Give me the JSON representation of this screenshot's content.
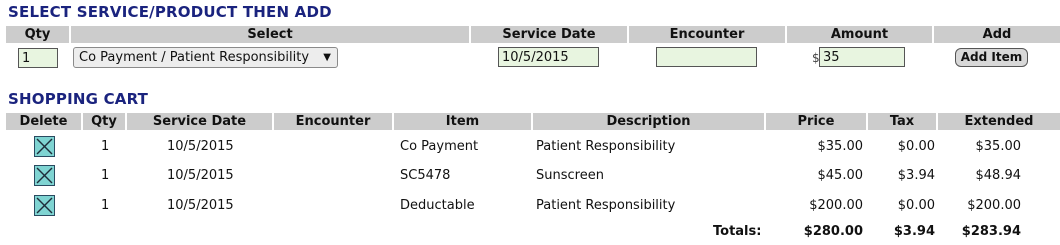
{
  "select_section": {
    "title": "SELECT SERVICE/PRODUCT THEN ADD",
    "headers": [
      "Qty",
      "Select",
      "Service Date",
      "Encounter",
      "Amount",
      "Add"
    ],
    "qty_value": "1",
    "select_value": "Co Payment / Patient Responsibility",
    "service_date_value": "10/5/2015",
    "encounter_value": "",
    "currency_symbol": "$",
    "amount_value": "35",
    "add_button_label": "Add Item"
  },
  "cart": {
    "title": "SHOPPING CART",
    "headers": [
      "Delete",
      "Qty",
      "Service Date",
      "Encounter",
      "Item",
      "Description",
      "Price",
      "Tax",
      "Extended"
    ],
    "rows": [
      {
        "qty": "1",
        "service_date": "10/5/2015",
        "encounter": "",
        "item": "Co Payment",
        "description": "Patient Responsibility",
        "price": "$35.00",
        "tax": "$0.00",
        "extended": "$35.00"
      },
      {
        "qty": "1",
        "service_date": "10/5/2015",
        "encounter": "",
        "item": "SC5478",
        "description": "Sunscreen",
        "price": "$45.00",
        "tax": "$3.94",
        "extended": "$48.94"
      },
      {
        "qty": "1",
        "service_date": "10/5/2015",
        "encounter": "",
        "item": "Deductable",
        "description": "Patient Responsibility",
        "price": "$200.00",
        "tax": "$0.00",
        "extended": "$200.00"
      }
    ],
    "totals_label": "Totals:",
    "total_price": "$280.00",
    "total_tax": "$3.94",
    "total_extended": "$283.94"
  },
  "colors": {
    "title": "#1a237e",
    "header_bg": "#cccccc",
    "input_bg": "#e8f5e0",
    "delete_icon": "#7fd4d2"
  }
}
